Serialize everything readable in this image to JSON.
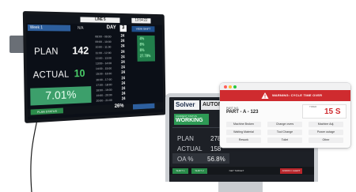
{
  "wall_display": {
    "line": "LINE 5",
    "clock": "13:54:22",
    "shift": "Week 1",
    "shift_sub": "N/A",
    "day_label": "DAY",
    "day_value": "3",
    "right_button": "VIEW SHIFT",
    "plan_label": "PLAN",
    "plan_value": "142",
    "actual_label": "ACTUAL",
    "actual_value": "10",
    "oa_value": "7.01%",
    "bottom_status": "PLAN STATUS",
    "bottom_pct": "26%",
    "table_rows": [
      {
        "time": "08:00 - 09:00",
        "num": "24"
      },
      {
        "time": "09:00 - 10:00",
        "num": "24"
      },
      {
        "time": "10:00 - 11:00",
        "num": "24"
      },
      {
        "time": "11:00 - 12:00",
        "num": "24"
      },
      {
        "time": "12:00 - 13:00",
        "num": "24"
      },
      {
        "time": "13:00 - 14:00",
        "num": "24"
      },
      {
        "time": "14:00 - 15:00",
        "num": "24"
      },
      {
        "time": "15:00 - 16:00",
        "num": "24"
      },
      {
        "time": "16:00 - 17:00",
        "num": "24"
      },
      {
        "time": "17:00 - 18:00",
        "num": "24"
      },
      {
        "time": "18:00 - 19:00",
        "num": "24"
      },
      {
        "time": "19:00 - 20:00",
        "num": "24"
      },
      {
        "time": "20:00 - 21:00",
        "num": "24"
      }
    ],
    "pct_column": [
      "4%",
      "8%",
      "8%",
      "27.78%"
    ]
  },
  "desk_display": {
    "logo": "Solver",
    "logo2": "AUTOMATION",
    "mode_small": "CURRENT STATUS",
    "mode": "WORKING",
    "plan_label": "PLAN",
    "plan_value": "278",
    "actual_label": "ACTUAL",
    "actual_value": "158",
    "oa_label": "OA %",
    "oa_value": "56.8%",
    "footer": [
      "SHIFT 1",
      "SHIFT 2",
      "NET TARGET",
      "ANDON / ALERT"
    ]
  },
  "popup": {
    "warning": "WARNING: CYCLE TIME OVER",
    "part_label": "PART NO.",
    "part_value": "PART - A - 123",
    "time_label": "TIMER",
    "time_value": "15 S",
    "buttons": [
      "Machine Broken",
      "Change overs",
      "Machine Adj.",
      "Waiting Material",
      "Tool Change",
      "Power outage",
      "Rework",
      "Toilet",
      "Other"
    ],
    "colors": {
      "banner": "#cf2b2f",
      "timer": "#cf2b2f"
    }
  }
}
